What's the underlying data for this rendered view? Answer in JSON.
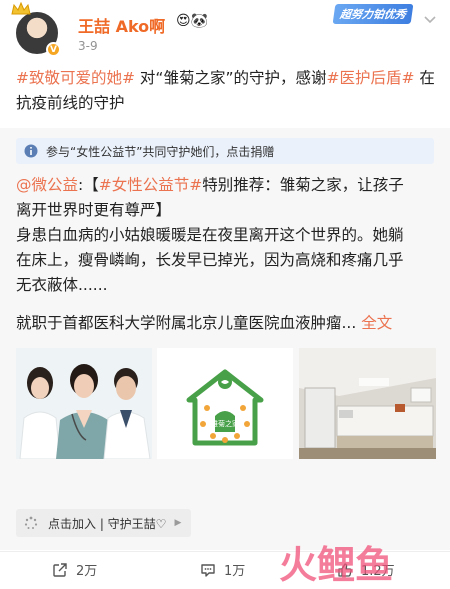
{
  "header": {
    "username": "王喆 Ako啊",
    "user_emojis": "😍🐼",
    "date": "3-9",
    "effort_badge": "超努力铂优秀",
    "verified_badge": "V"
  },
  "post": {
    "topic1": "#致敬可爱的她#",
    "text1": " 对“雏菊之家”的守护，感谢",
    "topic2": "#医护后盾#",
    "text2": " 在抗疫前线的守护"
  },
  "repost": {
    "charity_bar": "参与“女性公益节”共同守护她们，点击捐赠",
    "mention": "@微公益",
    "line1_a": ":【",
    "line1_topic": "#女性公益节#",
    "line1_b": "特别推荐：雏菊之家，让孩子",
    "line2": "离开世界时更有尊严】",
    "line3": "身患白血病的小姑娘暖暖是在夜里离开这个世界的。她躺",
    "line4": "在床上，瘦骨嶙峋，长发早已掉光，因为高烧和疼痛几乎",
    "line5": "无衣蔽体......",
    "line6": "就职于首都医科大学附属北京儿童医院血液肿瘤...",
    "read_more": "全文",
    "logo_text": "雏菊之家"
  },
  "join_tag": {
    "label": "点击加入 | 守护王喆♡"
  },
  "actions": {
    "repost_count": "2万",
    "comment_count": "1万",
    "like_count": "1.2万"
  },
  "watermark": {
    "text": "火鲤鱼"
  },
  "colors": {
    "accent": "#eb7350",
    "username": "#f06a27",
    "badge_blue": "#3d7ee0",
    "charity_bg": "#eaf1fb"
  }
}
